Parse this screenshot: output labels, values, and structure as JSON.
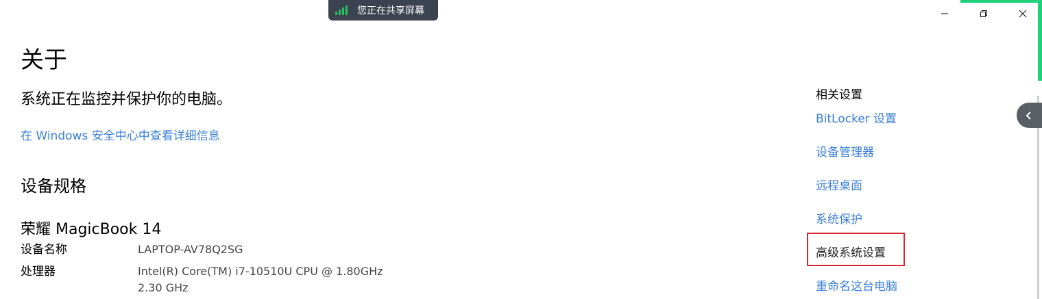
{
  "share_bar": {
    "text": "您正在共享屏幕",
    "icon": "signal-icon",
    "accent": "#22c55e"
  },
  "window": {
    "minimize_icon": "minimize-icon",
    "restore_icon": "restore-icon",
    "close_icon": "close-icon"
  },
  "main": {
    "title": "关于",
    "protection_text": "系统正在监控并保护你的电脑。",
    "security_link": "在 Windows 安全中心中查看详细信息",
    "spec_heading": "设备规格",
    "device_model": "荣耀 MagicBook 14",
    "specs": [
      {
        "label": "设备名称",
        "value": "LAPTOP-AV78Q2SG"
      },
      {
        "label": "处理器",
        "value": "Intel(R) Core(TM) i7-10510U CPU @ 1.80GHz   2.30 GHz"
      }
    ]
  },
  "related": {
    "title": "相关设置",
    "links": [
      {
        "label": "BitLocker 设置"
      },
      {
        "label": "设备管理器"
      },
      {
        "label": "远程桌面"
      },
      {
        "label": "系统保护"
      },
      {
        "label": "高级系统设置"
      },
      {
        "label": "重命名这台电脑"
      }
    ]
  },
  "colors": {
    "link": "#3a7fd6",
    "highlight_border": "#d9232d",
    "share_edge": "#1fd17a"
  }
}
